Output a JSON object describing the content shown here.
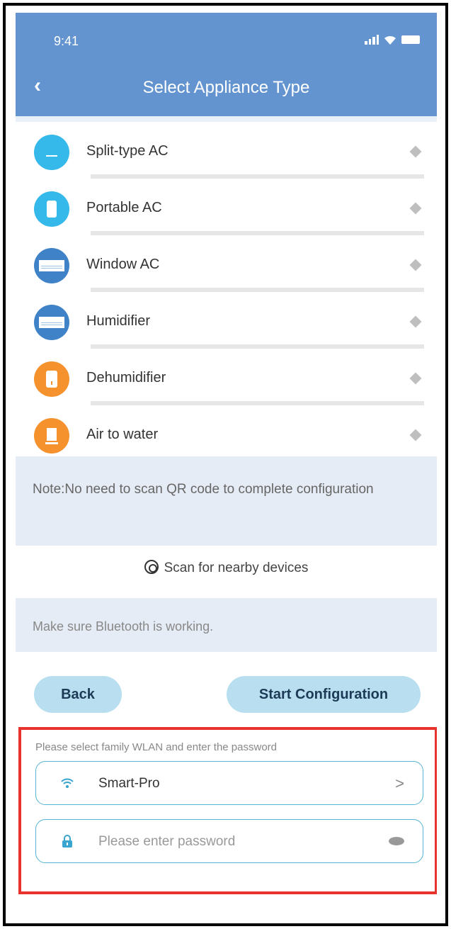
{
  "status": {
    "time": "9:41"
  },
  "header": {
    "title": "Select Appliance Type"
  },
  "appliances": [
    {
      "label": "Split-type AC",
      "icon": "split-ac-icon",
      "color": "#35b8ea"
    },
    {
      "label": "Portable AC",
      "icon": "portable-ac-icon",
      "color": "#35b8ea"
    },
    {
      "label": "Window AC",
      "icon": "window-ac-icon",
      "color": "#3f82c8"
    },
    {
      "label": "Humidifier",
      "icon": "humidifier-icon",
      "color": "#3f82c8"
    },
    {
      "label": "Dehumidifier",
      "icon": "dehumidifier-icon",
      "color": "#f5922d"
    },
    {
      "label": "Air to water",
      "icon": "air-to-water-icon",
      "color": "#f5922d"
    }
  ],
  "note": {
    "text": "Note:No need to scan QR code to complete configuration"
  },
  "scan": {
    "label": "Scan for nearby devices"
  },
  "hint": {
    "text": "Make sure Bluetooth is working."
  },
  "buttons": {
    "back": "Back",
    "start": "Start Configuration"
  },
  "wlan": {
    "instruction": "Please select family WLAN and enter the password",
    "ssid": "Smart-Pro",
    "ssid_chevron": ">",
    "password_placeholder": "Please enter password"
  },
  "colors": {
    "header": "#6394cf",
    "button": "#b8def0",
    "field_border": "#54b4d4",
    "highlight": "#e8322e"
  }
}
